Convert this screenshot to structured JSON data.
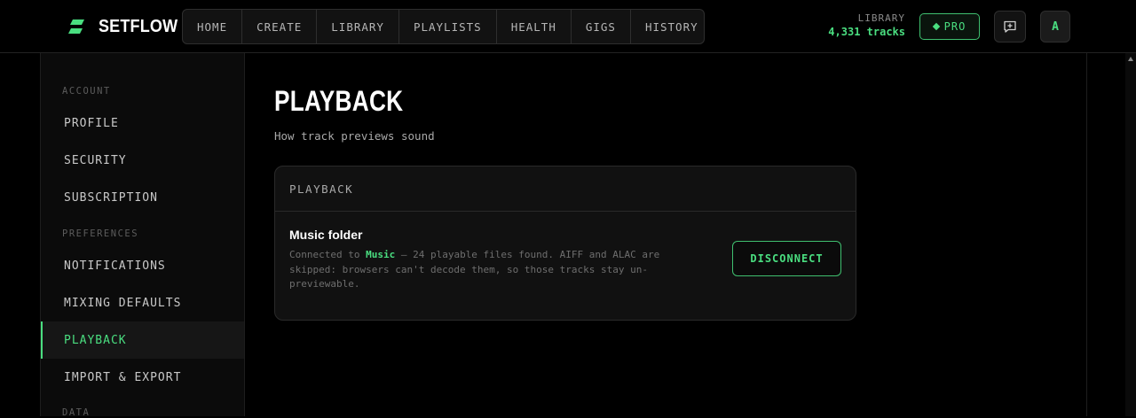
{
  "brand": {
    "name": "SETFLOW",
    "accent": "#4ade80"
  },
  "nav": [
    {
      "label": "HOME"
    },
    {
      "label": "CREATE"
    },
    {
      "label": "LIBRARY"
    },
    {
      "label": "PLAYLISTS"
    },
    {
      "label": "HEALTH"
    },
    {
      "label": "GIGS"
    },
    {
      "label": "HISTORY"
    }
  ],
  "library": {
    "label": "LIBRARY",
    "count": "4,331 tracks"
  },
  "header": {
    "pro_label": "PRO",
    "avatar_initial": "A",
    "feedback_icon": "message-plus-icon"
  },
  "sidebar": {
    "sections": [
      {
        "label": "ACCOUNT"
      },
      {
        "label": "PREFERENCES"
      },
      {
        "label": "DATA"
      }
    ],
    "items": [
      {
        "label": "PROFILE"
      },
      {
        "label": "SECURITY"
      },
      {
        "label": "SUBSCRIPTION"
      },
      {
        "label": "NOTIFICATIONS"
      },
      {
        "label": "MIXING DEFAULTS"
      },
      {
        "label": "PLAYBACK",
        "active": true
      },
      {
        "label": "IMPORT & EXPORT"
      }
    ]
  },
  "main": {
    "title": "PLAYBACK",
    "subtitle": "How track previews sound",
    "card": {
      "header": "PLAYBACK",
      "setting_title": "Music folder",
      "desc_prefix": "Connected to ",
      "folder_name": "Music",
      "desc_suffix": " — 24 playable files found. AIFF and ALAC are skipped: browsers can't decode them, so those tracks stay un-previewable.",
      "button_label": "DISCONNECT"
    }
  }
}
